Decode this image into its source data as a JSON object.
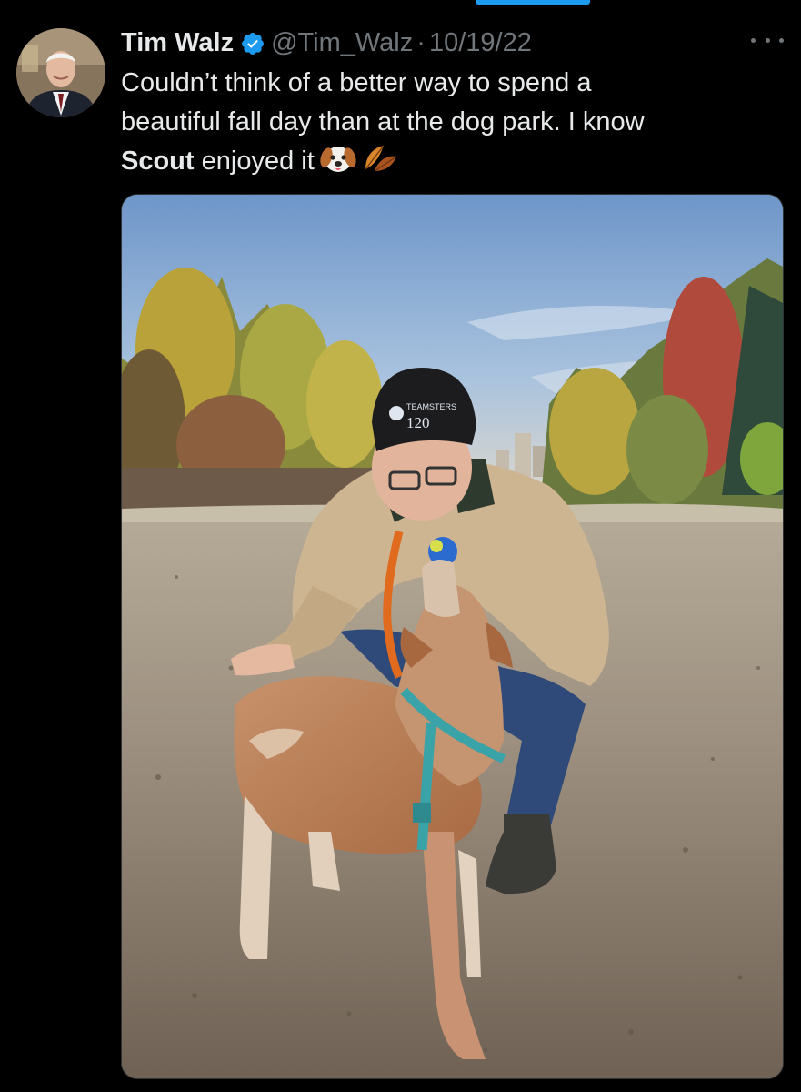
{
  "tweet": {
    "display_name": "Tim Walz",
    "handle": "@Tim_Walz",
    "separator": "·",
    "timestamp": "10/19/22",
    "text_line1": "Couldn’t think of a better way to spend a",
    "text_line2": "beautiful fall day than at the dog park. I know",
    "text_mention": "Scout",
    "text_end": " enjoyed it",
    "emojis": [
      "dog-face-emoji",
      "fallen-leaf-emoji"
    ],
    "photo_hat_text": "TEAMSTERS",
    "photo_hat_number": "120"
  },
  "colors": {
    "accent": "#1d9bf0",
    "background": "#000000",
    "text": "#e7e9ea",
    "muted": "#71767b"
  }
}
